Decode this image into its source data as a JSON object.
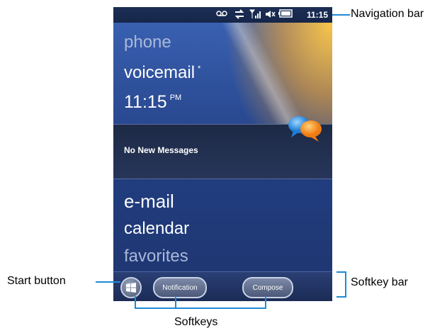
{
  "statusbar": {
    "time": "11:15"
  },
  "tiles": {
    "phone": "phone",
    "voicemail": "voicemail",
    "voicemail_marker": "*",
    "clock": "11:15",
    "clock_ampm": "PM",
    "messages": "No New Messages",
    "email": "e-mail",
    "calendar": "calendar",
    "favorites": "favorites"
  },
  "softkeys": {
    "left": "Notification",
    "right": "Compose"
  },
  "callouts": {
    "navigation_bar": "Navigation bar",
    "start_button": "Start button",
    "softkey_bar": "Softkey bar",
    "softkeys": "Softkeys"
  },
  "colors": {
    "callout_line": "#1f8ad6",
    "screen_background": "#2b4b94",
    "glow": "#ffb43c"
  },
  "icons": [
    "voicemail-icon",
    "data-sync-icon",
    "signal-icon",
    "speaker-muted-icon",
    "battery-icon",
    "chat-bubbles-icon",
    "windows-logo-icon"
  ]
}
